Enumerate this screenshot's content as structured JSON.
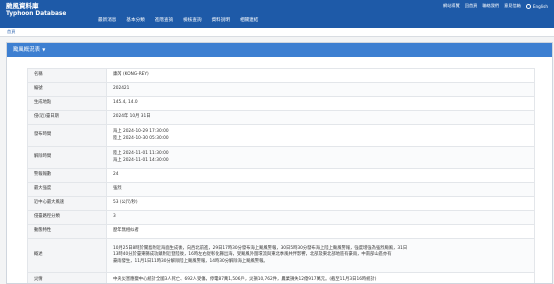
{
  "header": {
    "title_cn": "颱風資料庫",
    "title_en": "Typhoon Database",
    "nav": [
      "最新消息",
      "基本分類",
      "進階查詢",
      "檢核查詢",
      "資料說明",
      "相關連結"
    ],
    "util": [
      "網站導覽",
      "回首頁",
      "聯絡我們",
      "意見信箱",
      "English"
    ]
  },
  "breadcrumb": "首頁",
  "panel": {
    "title": "颱風概況表"
  },
  "rows": [
    {
      "label": "名稱",
      "lines": [
        "康芮 (KONG-REY)"
      ]
    },
    {
      "label": "編號",
      "lines": [
        "202421"
      ]
    },
    {
      "label": "生成地點",
      "lines": [
        "145.4, 14.0"
      ]
    },
    {
      "label": "侵(近)臺日期",
      "lines": [
        "2024年 10月 31日"
      ]
    },
    {
      "label": "發布時間",
      "lines": [
        "海上 2024-10-29 17:30:00",
        "陸上 2024-10-30 05:30:00"
      ]
    },
    {
      "label": "解除時間",
      "lines": [
        "陸上 2024-11-01 11:30:00",
        "海上 2024-11-01 14:30:00"
      ]
    },
    {
      "label": "警報報數",
      "lines": [
        "24"
      ]
    },
    {
      "label": "最大強度",
      "lines": [
        "強烈"
      ]
    },
    {
      "label": "近中心最大風速",
      "lines": [
        "53 (公尺/秒)"
      ]
    },
    {
      "label": "侵臺路徑分類",
      "lines": [
        "3"
      ]
    },
    {
      "label": "動態特性",
      "lines": [
        "歷年無相似者"
      ]
    },
    {
      "label": "概述",
      "lines": [
        "10月25日8時於關島附近海面生成後，向西北前進，29日17時30分發布海上颱風警報，30日5時30分發布海上陸上颱風警報，強度增強為強烈颱風，31日",
        "13時40分於臺東縣成功鎮附近登陸後，16時左右從彰化縣出海，受颱風外圍環流與東北季風共伴影響，北部及東北部地區有豪雨，中南部山區亦有",
        "豪雨發生，11月1日11時30分解除陸上颱風警報，14時30分解除海上颱風警報。"
      ]
    },
    {
      "label": "災情",
      "lines": [
        "中央災害應變中心統計全國3人死亡、692人受傷，停電87萬1,506戶，災損10,762件，農業損失12億917萬元。(截至11月3日16時統計)"
      ]
    }
  ]
}
